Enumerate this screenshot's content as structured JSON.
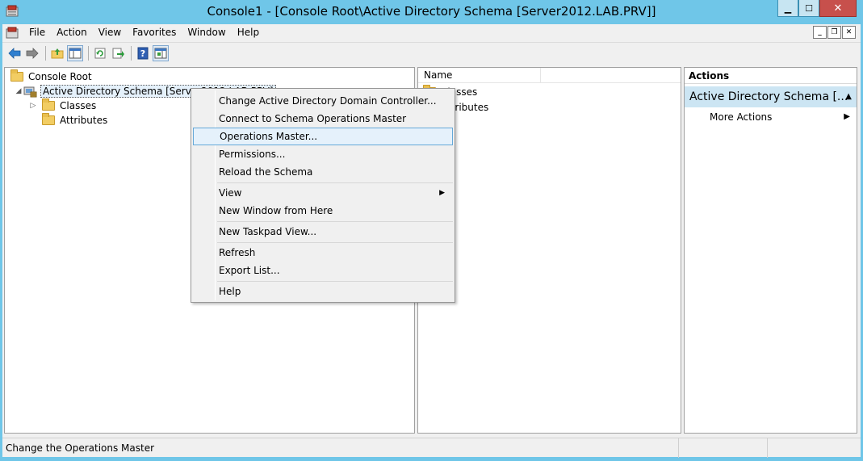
{
  "window": {
    "title": "Console1 - [Console Root\\Active Directory Schema [Server2012.LAB.PRV]]",
    "minimize_label": "▁",
    "maximize_label": "☐",
    "close_label": "✕"
  },
  "menubar": {
    "items": [
      "File",
      "Action",
      "View",
      "Favorites",
      "Window",
      "Help"
    ],
    "mdi_minimize": "_",
    "mdi_restore": "❐",
    "mdi_close": "✕"
  },
  "toolbar": {
    "icons": [
      "back-arrow-icon",
      "forward-arrow-icon",
      "up-folder-icon",
      "show-hide-console-tree-icon",
      "refresh-icon",
      "export-list-icon",
      "help-icon",
      "show-hide-action-pane-icon"
    ]
  },
  "tree": {
    "root": "Console Root",
    "schema_node": "Active Directory Schema [Server2012.LAB.PRV]",
    "children": [
      "Classes",
      "Attributes"
    ]
  },
  "list": {
    "column_name": "Name",
    "items": [
      "Classes",
      "Attributes"
    ]
  },
  "actions": {
    "header": "Actions",
    "section_title": "Active Directory Schema [...",
    "more_actions": "More Actions"
  },
  "context_menu": {
    "items": [
      "Change Active Directory Domain Controller...",
      "Connect to Schema Operations Master",
      "Operations Master...",
      "Permissions...",
      "Reload the Schema",
      "View",
      "New Window from Here",
      "New Taskpad View...",
      "Refresh",
      "Export List...",
      "Help"
    ],
    "highlighted": "Operations Master..."
  },
  "status": {
    "text": "Change the Operations Master"
  },
  "colors": {
    "titlebar": "#6fc6e8",
    "highlight": "#e5f1fb",
    "highlight_border": "#64a8d8",
    "actions_section": "#cce5f3",
    "close_button": "#c7504c"
  }
}
